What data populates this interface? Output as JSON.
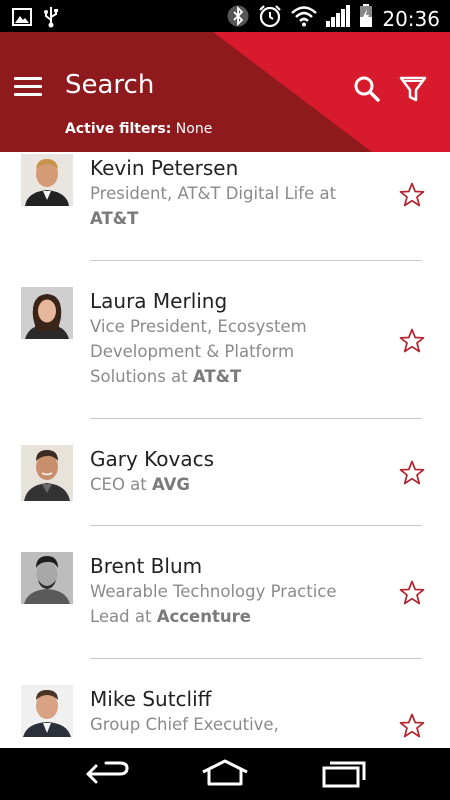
{
  "status_bar": {
    "time": "20:36",
    "icons": [
      "image-icon",
      "usb-icon",
      "bluetooth-icon",
      "alarm-icon",
      "wifi-icon",
      "signal-icon",
      "battery-icon"
    ]
  },
  "header": {
    "title": "Search",
    "filters_label": "Active filters:",
    "filters_value": "None",
    "colors": {
      "dark": "#8e1a1e",
      "accent": "#d71a2c"
    }
  },
  "results": [
    {
      "name": "Kevin Petersen",
      "title": "President, AT&T Digital Life at",
      "company": "AT&T",
      "starred": false
    },
    {
      "name": "Laura Merling",
      "title": "Vice President, Ecosystem Development & Platform Solutions at",
      "company": "AT&T",
      "starred": false
    },
    {
      "name": "Gary Kovacs",
      "title": "CEO at",
      "company": "AVG",
      "starred": false
    },
    {
      "name": "Brent Blum",
      "title": "Wearable Technology Practice Lead at",
      "company": "Accenture",
      "starred": false
    },
    {
      "name": "Mike Sutcliff",
      "title": "Group Chief Executive,",
      "company": "",
      "starred": false
    }
  ],
  "nav_bar": {
    "buttons": [
      "back-icon",
      "home-icon",
      "recents-icon"
    ]
  }
}
